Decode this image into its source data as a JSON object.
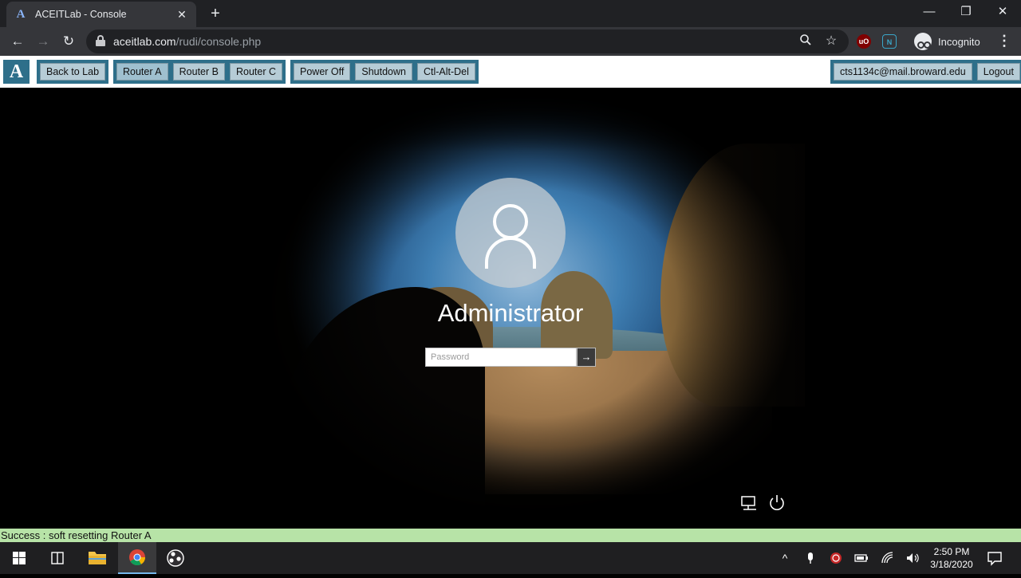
{
  "browser": {
    "tab_title": "ACEITLab - Console",
    "tab_favicon": "A",
    "new_tab_label": "+",
    "url_domain": "aceitlab.com",
    "url_path": "/rudi/console.php",
    "profile_label": "Incognito",
    "extension_ublock": "uO",
    "extension_other": "N"
  },
  "lab_toolbar": {
    "logo": "A",
    "back_label": "Back to Lab",
    "routers": [
      {
        "label": "Router A"
      },
      {
        "label": "Router B"
      },
      {
        "label": "Router C"
      }
    ],
    "power_actions": [
      {
        "label": "Power Off"
      },
      {
        "label": "Shutdown"
      },
      {
        "label": "Ctl-Alt-Del"
      }
    ],
    "user_email": "cts1134c@mail.broward.edu",
    "logout_label": "Logout"
  },
  "console": {
    "username": "Administrator",
    "password_placeholder": "Password",
    "submit_symbol": "→"
  },
  "status_message": "Success : soft resetting Router A",
  "taskbar": {
    "time": "2:50 PM",
    "date": "3/18/2020"
  },
  "colors": {
    "accent_teal": "#2e6f8a",
    "button_fill": "#b6ccd6",
    "status_bg": "#b7e3a7",
    "taskbar_bg": "#1f1f21"
  }
}
